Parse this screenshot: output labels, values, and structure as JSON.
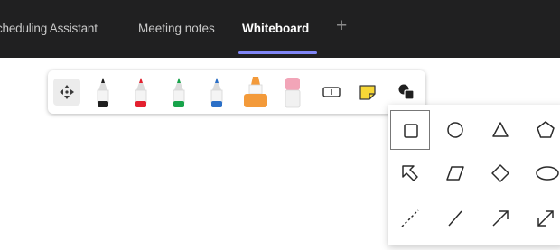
{
  "tabs": {
    "scheduling_assistant": "cheduling Assistant",
    "meeting_notes": "Meeting notes",
    "whiteboard": "Whiteboard",
    "add_symbol": "+"
  },
  "toolbar": {
    "active_tab_underline_color": "#7f85f5",
    "tools": [
      {
        "icon": "move-icon"
      },
      {
        "icon": "pen-icon",
        "color": "#1f1f1f"
      },
      {
        "icon": "pen-icon",
        "color": "#e3202f"
      },
      {
        "icon": "pen-icon",
        "color": "#17a34a"
      },
      {
        "icon": "pen-icon",
        "color": "#2b6fc7"
      },
      {
        "icon": "highlighter-icon",
        "color": "#f39a3a"
      },
      {
        "icon": "eraser-icon",
        "color": "#f2a5b8"
      },
      {
        "icon": "text-box-icon"
      },
      {
        "icon": "sticky-note-icon",
        "color": "#f7d736"
      },
      {
        "icon": "shapes-icon"
      }
    ]
  },
  "shape_panel": {
    "selected": "rectangle",
    "shapes": [
      "rectangle-icon",
      "circle-icon",
      "triangle-icon",
      "pentagon-icon",
      "block-arrow-icon",
      "parallelogram-icon",
      "diamond-icon",
      "ellipse-icon",
      "dashed-line-icon",
      "line-icon",
      "arrow-icon",
      "double-arrow-icon"
    ]
  }
}
